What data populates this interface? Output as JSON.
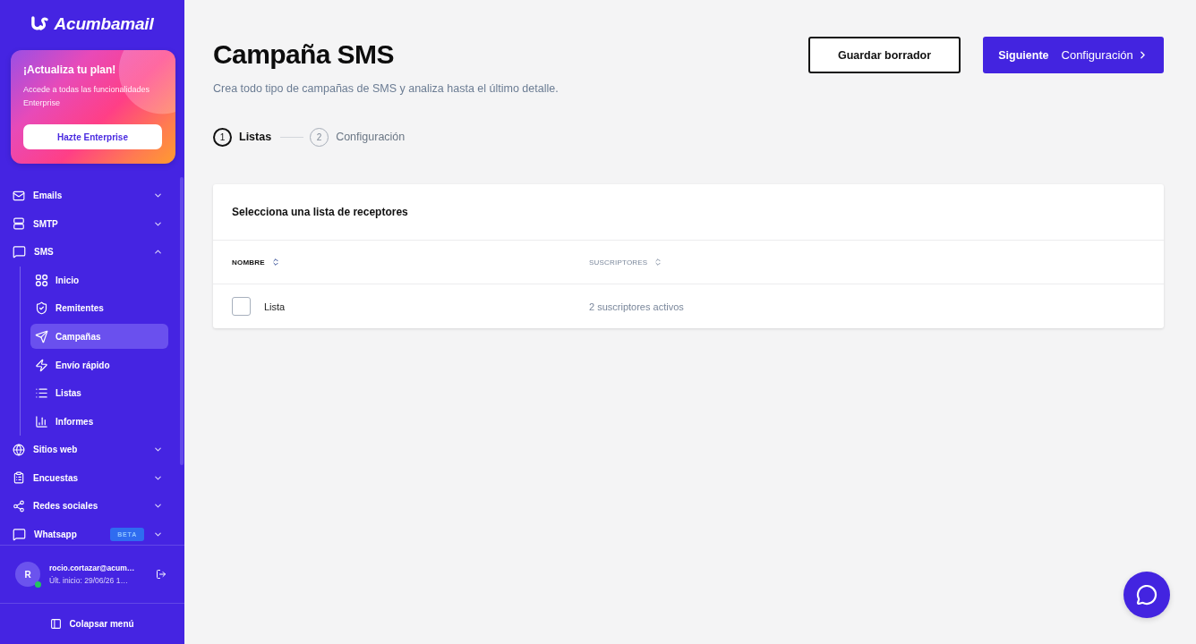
{
  "sidebar": {
    "logo": "Acumbamail",
    "promo": {
      "title": "¡Actualiza tu plan!",
      "text": "Accede a todas las funcionalidades Enterprise",
      "button": "Hazte Enterprise"
    },
    "menu": [
      {
        "label": "Emails",
        "expanded": false
      },
      {
        "label": "SMTP",
        "expanded": false
      },
      {
        "label": "SMS",
        "expanded": true,
        "children": [
          {
            "label": "Inicio",
            "selected": false
          },
          {
            "label": "Remitentes",
            "selected": false
          },
          {
            "label": "Campañas",
            "selected": true
          },
          {
            "label": "Envío rápido",
            "selected": false
          },
          {
            "label": "Listas",
            "selected": false
          },
          {
            "label": "Informes",
            "selected": false
          }
        ]
      },
      {
        "label": "Sitios web",
        "expanded": false
      },
      {
        "label": "Encuestas",
        "expanded": false
      },
      {
        "label": "Redes sociales",
        "expanded": false
      },
      {
        "label": "Whatsapp",
        "expanded": false,
        "badge": "BETA"
      }
    ],
    "user": {
      "initial": "R",
      "email": "rocio.cortazar@acum…",
      "last_login": "Últ. inicio: 29/06/26 1…",
      "online": true
    },
    "collapse_button": "Colapsar menú"
  },
  "header": {
    "title": "Campaña SMS",
    "subtitle": "Crea todo tipo de campañas de SMS y analiza hasta el último detalle.",
    "actions": [
      {
        "kind": "secondary",
        "label": "Guardar borrador"
      },
      {
        "kind": "primary",
        "label": "Siguiente",
        "detail": "Configuración"
      }
    ]
  },
  "steps": [
    {
      "number": "1",
      "label": "Listas",
      "selected": true
    },
    {
      "number": "2",
      "label": "Configuración",
      "selected": false
    }
  ],
  "list_card": {
    "title": "Selecciona una lista de receptores",
    "columns": [
      {
        "label": "NOMBRE",
        "active": true
      },
      {
        "label": "SUSCRIPTORES",
        "active": false
      }
    ],
    "rows": [
      {
        "name": "Lista",
        "subscribers": "2 suscriptores activos",
        "checked": false
      }
    ]
  }
}
